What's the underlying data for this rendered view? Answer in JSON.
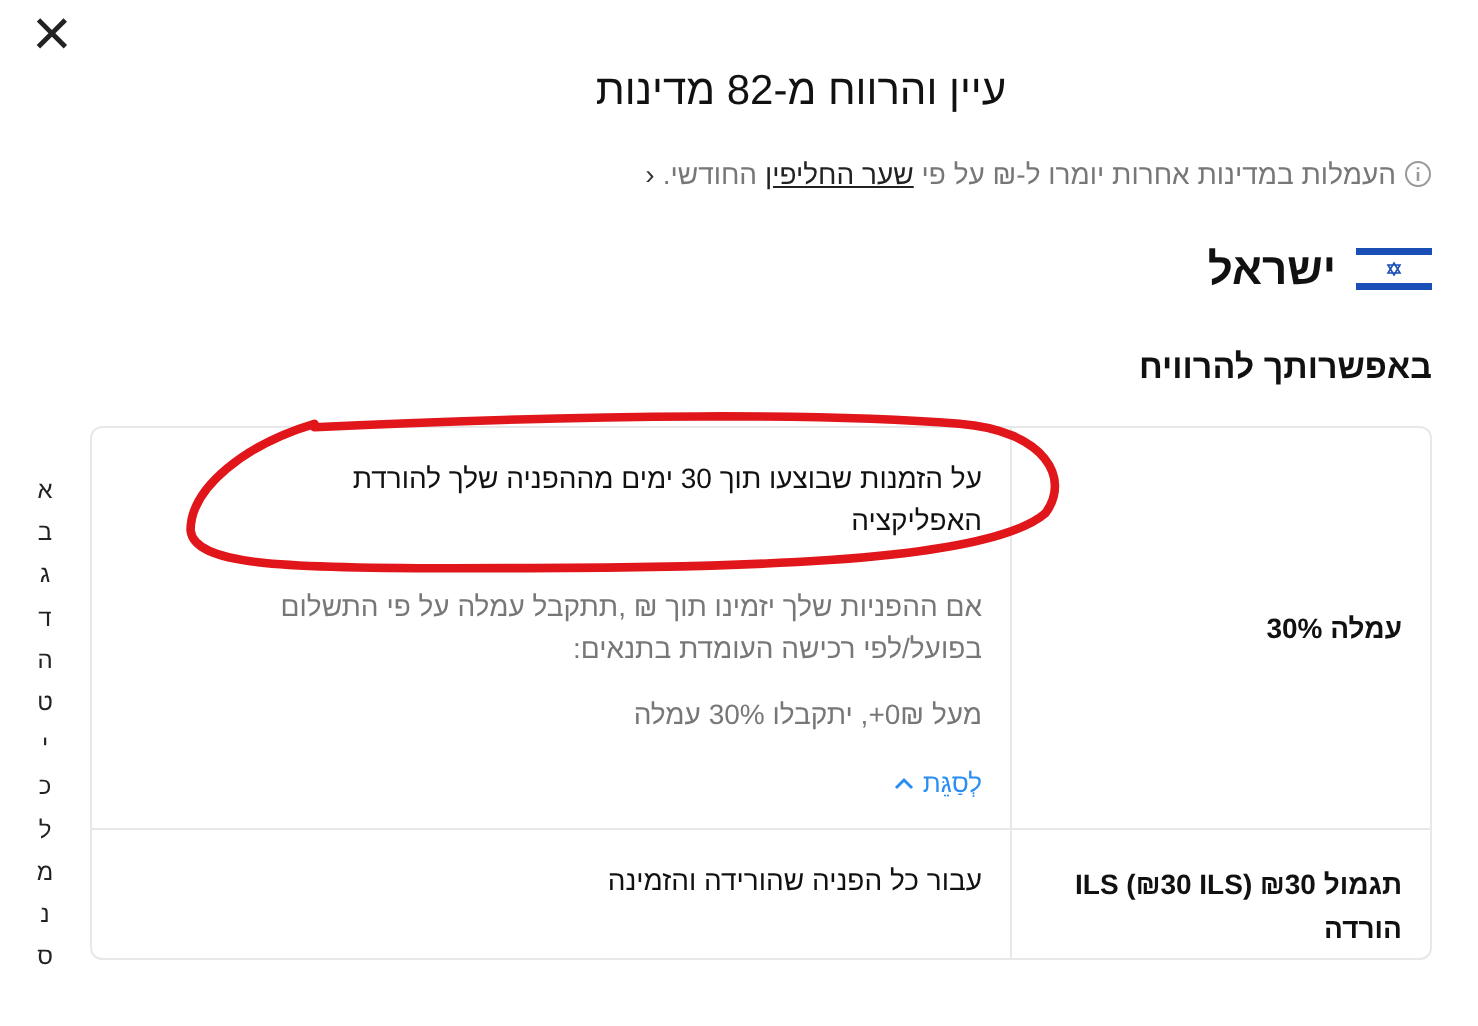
{
  "close_button": {
    "label": "×"
  },
  "title": "עיין והרווח מ-82 מדינות",
  "info": {
    "before": "העמלות במדינות אחרות יומרו ל-₪ על פי ",
    "link": "שער החליפין",
    "after": " החודשי.",
    "chevron": "‹"
  },
  "country": {
    "name": "ישראל"
  },
  "section_title": "באפשרותך להרוויח",
  "rows": [
    {
      "kind": "expanded",
      "label": "עמלה 30%",
      "primary": "על הזמנות שבוצעו תוך 30 ימים מההפניה שלך להורדת האפליקציה",
      "details": [
        "אם ההפניות שלך יזמינו תוך ₪ ,תתקבל עמלה על פי התשלום בפועל/לפי רכישה העומדת בתנאים:",
        "מעל 0₪+, יתקבלו 30% עמלה"
      ],
      "toggle": "לְסַגֵּת"
    },
    {
      "kind": "plain",
      "label": "תגמול ₪30 ILS (₪30 ILS) הורדה",
      "primary": "עבור כל הפניה שהורידה והזמינה"
    }
  ],
  "index_letters": [
    "א",
    "ב",
    "ג",
    "ד",
    "ה",
    "ט",
    "י",
    "כ",
    "ל",
    "מ",
    "נ",
    "ס"
  ]
}
